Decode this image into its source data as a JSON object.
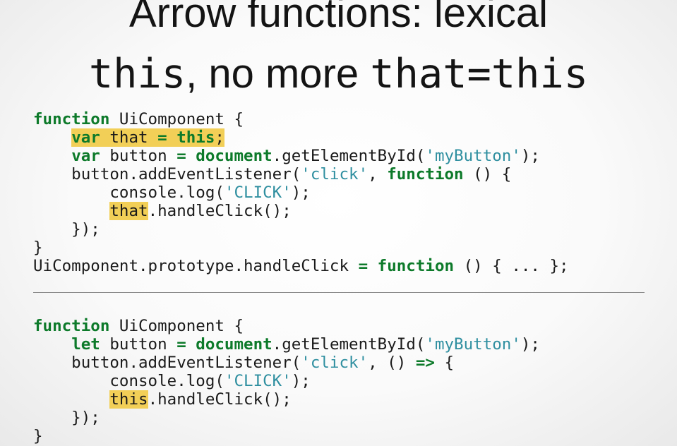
{
  "title": {
    "line1": "Arrow functions: lexical",
    "line2_part1": "this",
    "line2_part2": ", no more ",
    "line2_part3": "that=this"
  },
  "code_before": [
    [
      {
        "t": "function",
        "c": "kw"
      },
      {
        "t": " UiComponent {"
      }
    ],
    [
      {
        "t": "    "
      },
      {
        "t": "var that = this;",
        "c": "hl",
        "sub": [
          {
            "t": "var",
            "c": "kw"
          },
          {
            "t": " that "
          },
          {
            "t": "=",
            "c": "kw"
          },
          {
            "t": " "
          },
          {
            "t": "this",
            "c": "kw"
          },
          {
            "t": ";"
          }
        ]
      }
    ],
    [
      {
        "t": "    "
      },
      {
        "t": "var",
        "c": "kw"
      },
      {
        "t": " button "
      },
      {
        "t": "=",
        "c": "kw"
      },
      {
        "t": " "
      },
      {
        "t": "document",
        "c": "kw"
      },
      {
        "t": ".getElementById("
      },
      {
        "t": "'myButton'",
        "c": "str"
      },
      {
        "t": ");"
      }
    ],
    [
      {
        "t": "    button.addEventListener("
      },
      {
        "t": "'click'",
        "c": "str"
      },
      {
        "t": ", "
      },
      {
        "t": "function",
        "c": "kw"
      },
      {
        "t": " () {"
      }
    ],
    [
      {
        "t": "        console.log("
      },
      {
        "t": "'CLICK'",
        "c": "str"
      },
      {
        "t": ");"
      }
    ],
    [
      {
        "t": "        "
      },
      {
        "t": "that",
        "c": "hl"
      },
      {
        "t": ".handleClick();"
      }
    ],
    [
      {
        "t": "    });"
      }
    ],
    [
      {
        "t": "}"
      }
    ],
    [
      {
        "t": "UiComponent.prototype.handleClick "
      },
      {
        "t": "=",
        "c": "kw"
      },
      {
        "t": " "
      },
      {
        "t": "function",
        "c": "kw"
      },
      {
        "t": " () { ... };"
      }
    ]
  ],
  "code_after": [
    [
      {
        "t": "function",
        "c": "kw"
      },
      {
        "t": " UiComponent {"
      }
    ],
    [
      {
        "t": "    "
      },
      {
        "t": "let",
        "c": "kw"
      },
      {
        "t": " button "
      },
      {
        "t": "=",
        "c": "kw"
      },
      {
        "t": " "
      },
      {
        "t": "document",
        "c": "kw"
      },
      {
        "t": ".getElementById("
      },
      {
        "t": "'myButton'",
        "c": "str"
      },
      {
        "t": ");"
      }
    ],
    [
      {
        "t": "    button.addEventListener("
      },
      {
        "t": "'click'",
        "c": "str"
      },
      {
        "t": ", () "
      },
      {
        "t": "=>",
        "c": "kw"
      },
      {
        "t": " {"
      }
    ],
    [
      {
        "t": "        console.log("
      },
      {
        "t": "'CLICK'",
        "c": "str"
      },
      {
        "t": ");"
      }
    ],
    [
      {
        "t": "        "
      },
      {
        "t": "this",
        "c": "hl"
      },
      {
        "t": ".handleClick();"
      }
    ],
    [
      {
        "t": "    });"
      }
    ],
    [
      {
        "t": "}"
      }
    ]
  ],
  "colors": {
    "keyword": "#0d7a2a",
    "string": "#2f8fa0",
    "highlight": "#f2cf57",
    "text": "#1a1a1a"
  }
}
